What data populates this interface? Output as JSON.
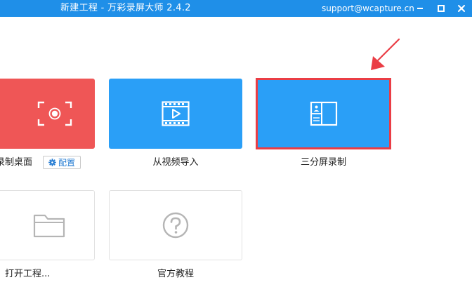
{
  "window": {
    "title": "新建工程 - 万彩录屏大师 2.4.2",
    "support_email": "support@wcapture.cn"
  },
  "tiles": {
    "record_desktop": {
      "label": "录制桌面",
      "config_label": "配置",
      "icon": "record-screen-icon"
    },
    "import_video": {
      "label": "从视频导入",
      "icon": "video-film-icon"
    },
    "split_screen": {
      "label": "三分屏录制",
      "icon": "split-screen-icon",
      "selected": true
    },
    "open_project": {
      "label": "打开工程...",
      "icon": "folder-icon"
    },
    "tutorial": {
      "label": "官方教程",
      "icon": "question-icon"
    }
  },
  "colors": {
    "titlebar": "#1f8fe8",
    "record_tile": "#ef5656",
    "blue_tile": "#2a9ff7",
    "highlight": "#ea3d45",
    "link": "#1f78d1"
  }
}
